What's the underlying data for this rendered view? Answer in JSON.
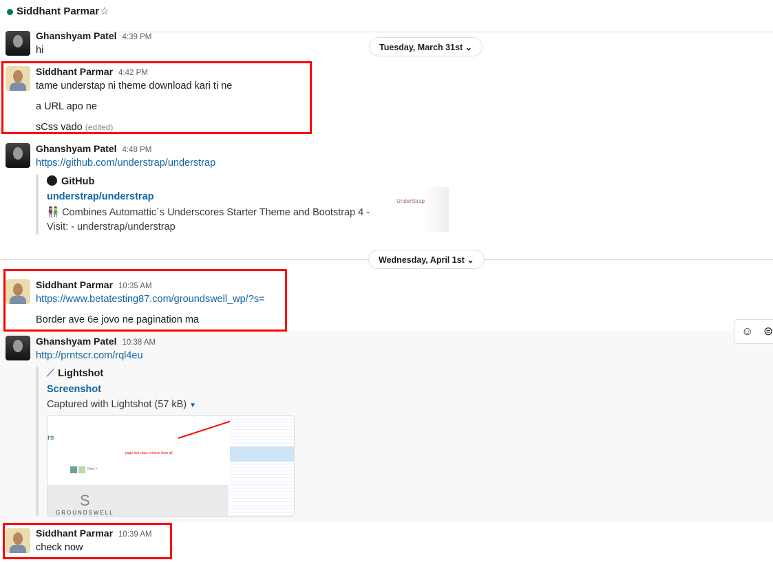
{
  "header": {
    "title": "Siddhant Parmar",
    "star_icon": "star-icon"
  },
  "dividers": [
    "Tuesday, March 31st",
    "Wednesday, April 1st"
  ],
  "messages": [
    {
      "name": "Ghanshyam Patel",
      "time": "4:39 PM",
      "lines": [
        "hi"
      ]
    },
    {
      "name": "Siddhant Parmar",
      "time": "4:42 PM",
      "lines": [
        "tame understap ni theme download kari ti ne",
        "a URL apo ne",
        "sCss vado"
      ],
      "edited": "(edited)"
    },
    {
      "name": "Ghanshyam Patel",
      "time": "4:48 PM",
      "link": "https://github.com/understrap/understrap",
      "attachment": {
        "service": "GitHub",
        "title": "understrap/understrap",
        "desc1": "👫 Combines Automattic´s Underscores Starter Theme and Bootstrap 4 -",
        "desc2": "Visit: - understrap/understrap",
        "thumb_text": "UnderStrap"
      }
    },
    {
      "name": "Siddhant Parmar",
      "time": "10:35 AM",
      "link": "https://www.betatesting87.com/groundswell_wp/?s=",
      "lines": [
        "Border ave 6e jovo ne pagination ma"
      ]
    },
    {
      "name": "Ghanshyam Patel",
      "time": "10:38 AM",
      "link": "http://prntscr.com/rql4eu",
      "attachment": {
        "service": "Lightshot",
        "title": "Screenshot",
        "desc1": "Captured with Lightshot (57 kB)",
        "img_annotation": "page link class remove from all",
        "img_logo": "GROUNDSWELL",
        "img_next": "Next >",
        "img_heading": "rs"
      }
    },
    {
      "name": "Siddhant Parmar",
      "time": "10:39 AM",
      "lines": [
        "check now"
      ]
    }
  ],
  "colors": {
    "accent": "#1264a3",
    "highlight": "#ff0000",
    "online": "#007a5a"
  }
}
